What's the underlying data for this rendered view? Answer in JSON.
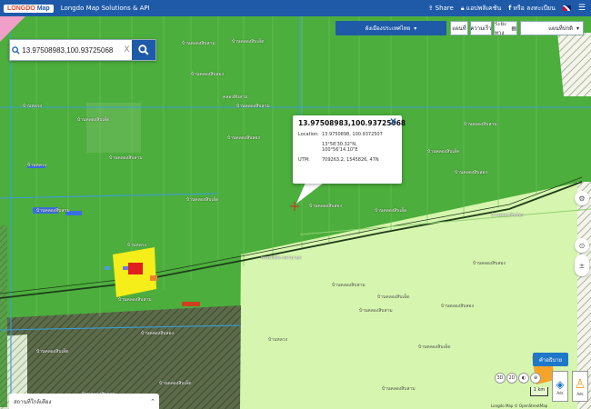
{
  "topbar": {
    "logo_text": "LONGDO",
    "logo_accent": "Map",
    "title": "Longdo Map Solutions & API",
    "share": "Share",
    "apps": "แอปพลิเคชัน",
    "login": "หรือ ลงทะเบียน"
  },
  "search": {
    "value": "13.97508983,100.93725068",
    "clear": "X"
  },
  "controls": {
    "layer_dropdown": "ผังเมืองประเทศไทย",
    "btn_map": "แผนที่",
    "btn_traffic": "ความเร็ว",
    "btn_distance": "ระยะทาง",
    "btn_style": "แผนที่ปกติ"
  },
  "popup": {
    "title": "13.97508983,100.93725068",
    "close": "X",
    "location_label": "Location:",
    "location_value": "13.9750898, 100.9372507",
    "dms_lat": "13°58'30.32\"N,",
    "dms_lon": "100°56'14.10\"E",
    "utm_label": "UTM:",
    "utm_value": "709263.2, 1545826, 47N"
  },
  "map_labels": {
    "road_a": "ถนนรังสิต-นครนายก",
    "road_b": "คลองสิบสาม",
    "area_a": "บ้านคลองสิบสาม",
    "area_b": "บ้านคลองสิบเอ็ด",
    "area_c": "บ้านคลองสิบสอง",
    "area_d": "บ้านหลวง"
  },
  "legend": {
    "label": "คำอธิบาย"
  },
  "mini_tools": [
    "3D",
    "2D",
    "◐",
    "⊕"
  ],
  "scale": {
    "label": "1 km"
  },
  "pegman": {
    "label_a": "Ads",
    "label_b": "Ads"
  },
  "attribution": "Longdo Map © OpenStreetMap",
  "bottom_panel": {
    "label": "สถานที่ใกล้เคียง",
    "chevron": "⌃"
  },
  "colors": {
    "topbar": "#1e5aa8",
    "agri_green": "#4cae3c",
    "light_green": "#d4f5a8",
    "dark_hatch": "#5a6a48",
    "residential_yellow": "#f5ee1a",
    "commercial_red": "#e02020"
  }
}
